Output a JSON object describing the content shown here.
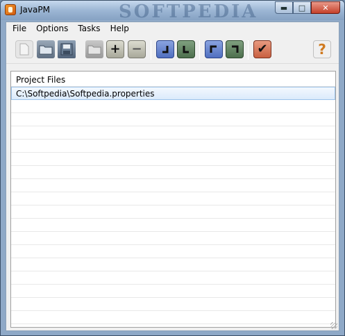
{
  "window": {
    "title": "JavaPM",
    "watermark": "SOFTPEDIA",
    "controls": {
      "minimize": "▬",
      "maximize": "□",
      "close": "✕"
    }
  },
  "menu": [
    "File",
    "Options",
    "Tasks",
    "Help"
  ],
  "toolbar": {
    "buttons": [
      {
        "icon": "new-document-icon"
      },
      {
        "icon": "open-folder-icon"
      },
      {
        "icon": "save-disk-icon"
      },
      {
        "icon": "folder-disabled-icon"
      },
      {
        "icon": "add-icon",
        "glyph": "+"
      },
      {
        "icon": "remove-icon",
        "glyph": "−"
      },
      {
        "icon": "arrow-down-left-icon"
      },
      {
        "icon": "arrow-down-right-icon"
      },
      {
        "icon": "arrow-up-left-icon"
      },
      {
        "icon": "arrow-up-right-icon"
      },
      {
        "icon": "checkmark-icon",
        "glyph": "✔"
      },
      {
        "icon": "help-icon",
        "glyph": "?"
      }
    ]
  },
  "list": {
    "header": "Project Files",
    "rows": [
      "C:\\Softpedia\\Softpedia.properties"
    ]
  },
  "colors": {
    "selection": "#dbeafb",
    "accent_blue": "#4f6fc0",
    "accent_green": "#4d6f4d",
    "accent_orange": "#c86040"
  }
}
